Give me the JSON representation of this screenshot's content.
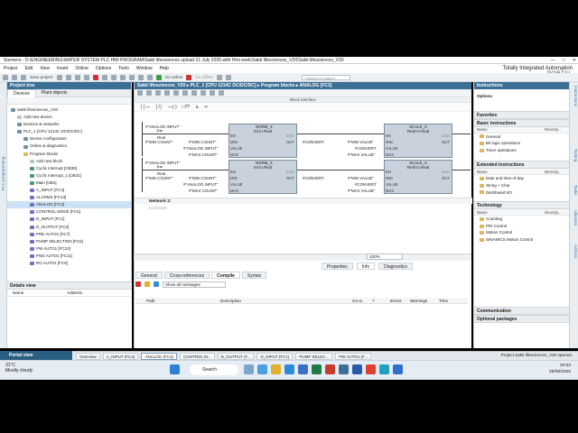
{
  "window": {
    "title": "Siemens - D:\\ENGINEERING\\WATER SYSTEM PLC HMI PROGRAM\\Sakti lifesciences upload 21 July 2025-with Hmi work\\Sakti lifesciences_V20\\Sakti lifesciences_V20"
  },
  "menu": [
    "Project",
    "Edit",
    "View",
    "Insert",
    "Online",
    "Options",
    "Tools",
    "Window",
    "Help"
  ],
  "brand": {
    "line1": "Totally Integrated Automation",
    "line2": "PORTAL"
  },
  "toolbar": {
    "save_label": "Save project",
    "go_online": "Go online",
    "go_offline": "Go offline",
    "search_placeholder": "<Search in project>"
  },
  "project_tree": {
    "header": "Project tree",
    "tabs": [
      "Devices",
      "Plant objects"
    ],
    "vertical_label": "PLC programming",
    "items": [
      {
        "label": "Sakti lifesciences_V20",
        "indent": 0,
        "icon": "project"
      },
      {
        "label": "Add new device",
        "indent": 1,
        "icon": "add"
      },
      {
        "label": "Devices & networks",
        "indent": 1,
        "icon": "device"
      },
      {
        "label": "PLC_1 [CPU 1214C DC/DC/DC]",
        "indent": 1,
        "icon": "device"
      },
      {
        "label": "Device configuration",
        "indent": 2,
        "icon": "device"
      },
      {
        "label": "Online & diagnostics",
        "indent": 2,
        "icon": "device"
      },
      {
        "label": "Program blocks",
        "indent": 2,
        "icon": "folder"
      },
      {
        "label": "Add new block",
        "indent": 3,
        "icon": "add"
      },
      {
        "label": "Cyclic interrupt [OB30]",
        "indent": 3,
        "icon": "block"
      },
      {
        "label": "Cyclic interrupt_1 [OB31]",
        "indent": 3,
        "icon": "block"
      },
      {
        "label": "Main [OB1]",
        "indent": 3,
        "icon": "block"
      },
      {
        "label": "A_INPUT [FC4]",
        "indent": 3,
        "icon": "fc"
      },
      {
        "label": "ALARMS [FC13]",
        "indent": 3,
        "icon": "fc"
      },
      {
        "label": "ANALOG [FC3]",
        "indent": 3,
        "icon": "fc",
        "selected": true
      },
      {
        "label": "CONTROL MODE [FC5]",
        "indent": 3,
        "icon": "fc"
      },
      {
        "label": "D_INPUT [FC1]",
        "indent": 3,
        "icon": "fc"
      },
      {
        "label": "D_OUTPUT [FC2]",
        "indent": 3,
        "icon": "fc"
      },
      {
        "label": "PRE AUTO1 [FC7]",
        "indent": 3,
        "icon": "fc"
      },
      {
        "label": "PUMP SELECTION [FC6]",
        "indent": 3,
        "icon": "fc"
      },
      {
        "label": "PW AUTO1 [FC10]",
        "indent": 3,
        "icon": "fc"
      },
      {
        "label": "PW2 AUTO1 [FC11]",
        "indent": 3,
        "icon": "fc"
      },
      {
        "label": "RO AUTO1 [FC9]",
        "indent": 3,
        "icon": "fc"
      }
    ]
  },
  "details_view": {
    "header": "Details view",
    "columns": [
      "Name",
      "Address"
    ]
  },
  "editor": {
    "breadcrumb": "Sakti lifesciences_V20  ▸  PLC_1 [CPU 1214C DC/DC/DC]  ▸  Program blocks  ▸  ANALOG [FC3]",
    "interface_label": "Block interface",
    "network2_label": "Network 2:",
    "comment_placeholder": "Comment",
    "zoom": "100%",
    "rungs": [
      {
        "input_tag": "#\"ANALOG INPUT\"",
        "cmp": ">=",
        "cmp_type": "Real",
        "cmp_operand": "#\"MIN COUNT\"",
        "norm": {
          "title": "NORM_X",
          "subtitle": "Int to Real",
          "min": "#\"MIN COUNT\"",
          "value": "#\"ANALOG INPUT\"",
          "max": "#\"MAX COUNT\"",
          "out": "#CONVERT"
        },
        "scale": {
          "title": "SCALE_X",
          "subtitle": "Real to Real",
          "min": "#\"MIN VALUE\"",
          "value": "#CONVERT",
          "max": "#\"MAX VALUE\"",
          "out": ""
        }
      },
      {
        "input_tag": "#\"ANALOG INPUT\"",
        "cmp": ">=",
        "cmp_type": "Real",
        "cmp_operand": "#\"MIN COUNT\"",
        "norm": {
          "title": "NORM_X",
          "subtitle": "Int to Real",
          "min": "#\"MIN COUNT\"",
          "value": "#\"ANALOG INPUT\"",
          "max": "#\"MAX COUNT\"",
          "out": "#CONVERT"
        },
        "scale": {
          "title": "SCALE_X",
          "subtitle": "Real to Real",
          "min": "#\"MIN VALUE\"",
          "value": "#CONVERT",
          "max": "#\"MAX VALUE\"",
          "out": ""
        }
      }
    ],
    "pins": {
      "en": "EN",
      "eno": "ENO",
      "min": "MIN",
      "value": "VALUE",
      "max": "MAX",
      "out": "OUT"
    }
  },
  "inspector": {
    "top_tabs": [
      "Properties",
      "Info",
      "Diagnostics"
    ],
    "tabs": [
      "General",
      "Cross-references",
      "Compile",
      "Syntax"
    ],
    "active_tab": "Compile",
    "filter": "Show all messages",
    "columns": [
      "Path",
      "Description",
      "Go to",
      "?",
      "Errors",
      "Warnings",
      "Time"
    ]
  },
  "right_panel": {
    "header": "Instructions",
    "options_label": "Options",
    "favorites": "Favorites",
    "basic": "Basic instructions",
    "col_name": "Name",
    "col_desc": "Descrip...",
    "basic_items": [
      "General",
      "Bit logic operations",
      "Timer operations"
    ],
    "extended": "Extended instructions",
    "extended_items": [
      "Date and time-of-day",
      "String + Char",
      "Distributed I/O"
    ],
    "technology": "Technology",
    "technology_items": [
      "Counting",
      "PID Control",
      "Motion Control",
      "SINAMICS Motion Control"
    ],
    "communication": "Communication",
    "optional": "Optional packages",
    "vertical_tabs": [
      "Instructions",
      "Testing",
      "Tasks",
      "Libraries",
      "Add-ins"
    ]
  },
  "portal": {
    "portal_view": "Portal view",
    "tasks": [
      "Overview",
      "A_INPUT (FC4)",
      "ANALOG (FC3)",
      "CONTROL M...",
      "D_OUTPUT (F...",
      "D_INPUT (FC1)",
      "PUMP SELEC...",
      "PW AUTO1 (F..."
    ],
    "status": "Project Sakti lifesciences_V20 opened."
  },
  "taskbar": {
    "weather_temp": "31°C",
    "weather_desc": "Mostly cloudy",
    "search": "Search",
    "time": "20:03",
    "date": "28/08/2026"
  },
  "colors": {
    "accent": "#3b6f95",
    "box": "#c9d2dc"
  }
}
